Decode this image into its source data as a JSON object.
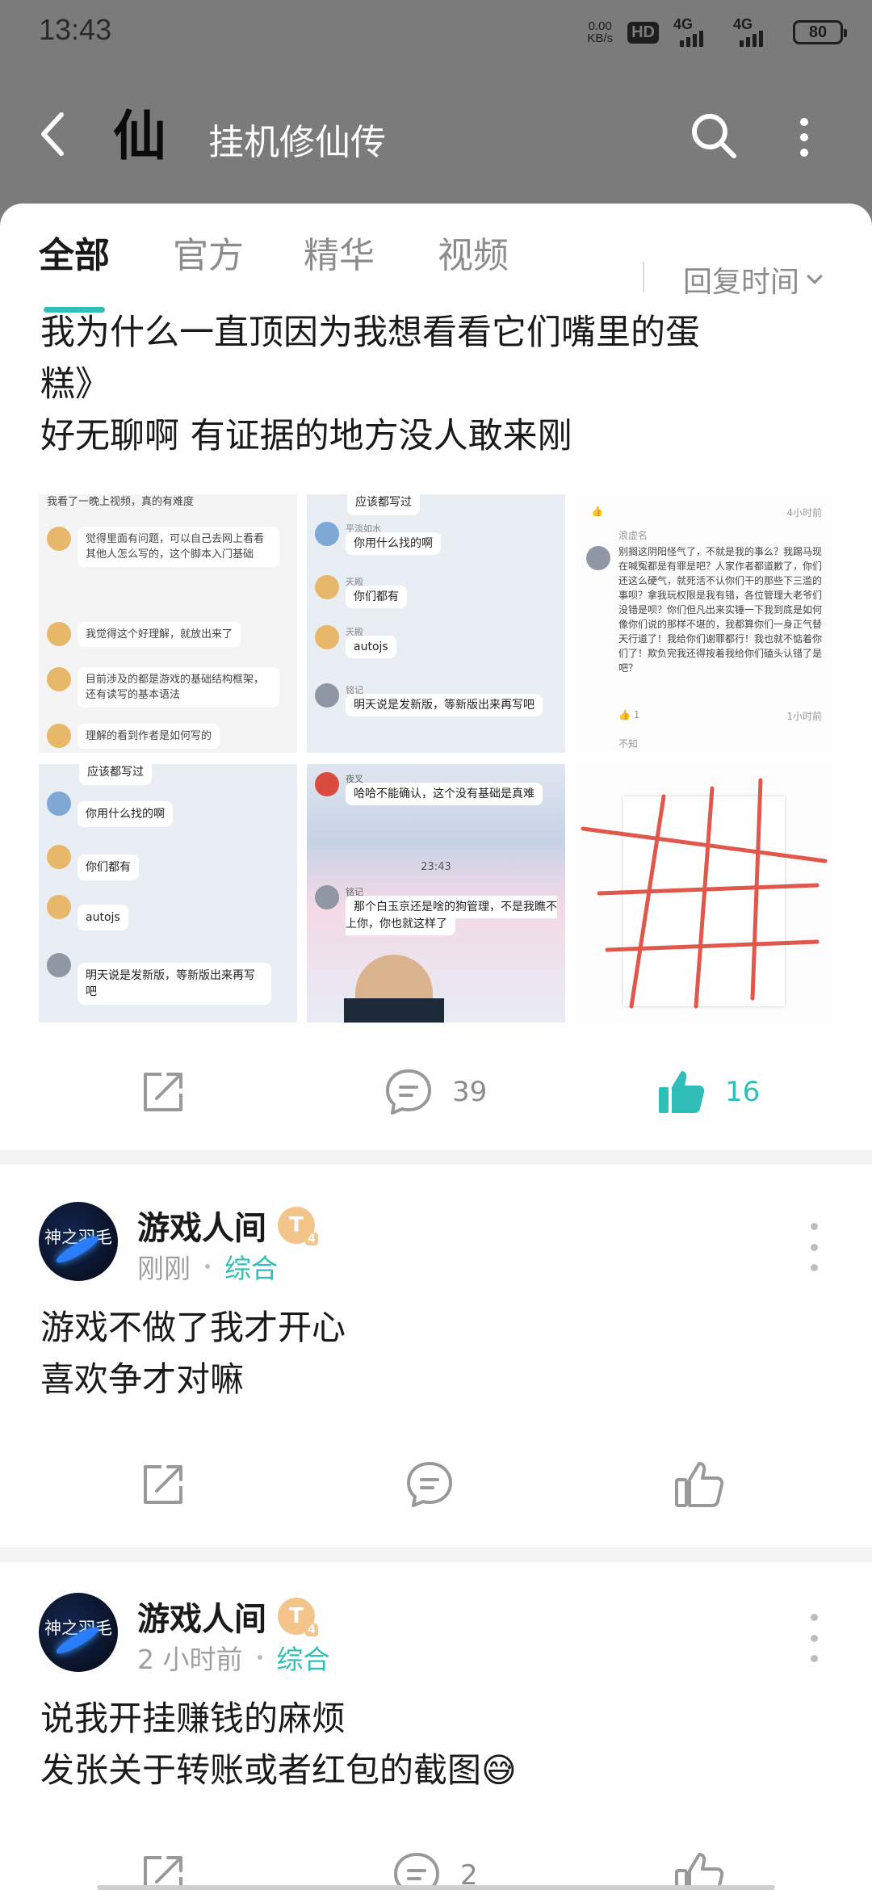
{
  "status_bar": {
    "time": "13:43",
    "net_speed_value": "0.00",
    "net_speed_unit": "KB/s",
    "hd": "HD",
    "sim1": "4G",
    "sim2": "4G",
    "battery": "80"
  },
  "header": {
    "logo_text": "仙",
    "title": "挂机修仙传"
  },
  "tabs": {
    "items": [
      {
        "label": "全部",
        "active": true
      },
      {
        "label": "官方",
        "active": false
      },
      {
        "label": "精华",
        "active": false
      },
      {
        "label": "视频",
        "active": false
      }
    ],
    "sort_label": "回复时间"
  },
  "post1": {
    "lines": [
      "我为什么一直顶因为我想看看它们嘴里的蛋",
      "糕》",
      "好无聊啊  有证据的地方没人敢来刚"
    ],
    "images": {
      "img1": {
        "lines": [
          "我看了一晚上视频，真的有难度",
          "觉得里面有问题，可以自己去网上看看其他人怎么写的，这个脚本入门基础",
          "我觉得这个好理解，就放出来了",
          "目前涉及的都是游戏的基础结构框架，还有读写的基本语法",
          "理解的看到作者是如何写的"
        ]
      },
      "img2": {
        "messages": [
          "应该都写过",
          "你用什么找的啊",
          "你们都有",
          "autojs",
          "明天说是发新版，等新版出来再写吧"
        ],
        "names": [
          "平淡如水",
          "天殿",
          "天殿",
          "铭记"
        ]
      },
      "img3": {
        "name": "浪虚名",
        "time1": "4小时前",
        "time2": "1小时前",
        "comment": "别搁这阴阳怪气了，不就是我的事么？我踢马现在喊冤都是有罪是吧？人家作者都道歉了，你们还这么硬气，就死活不认你们干的那些下三滥的事呗？拿我玩权限是我有错，各位管理大老爷们没错是呗？你们但凡出来实锤一下我到底是如何像你们说的那样不堪的，我都算你们一身正气替天行道了！我给你们谢罪都行！我也就不惦着你们了！欺负完我还得按着我给你们磕头认错了是吧？",
        "likes": "1",
        "reply_name": "不知"
      },
      "img4": {
        "messages": [
          "应该都写过",
          "你用什么找的啊",
          "你们都有",
          "autojs",
          "明天说是发新版，等新版出来再写吧"
        ]
      },
      "img5": {
        "messages": [
          "哈哈不能确认，这个没有基础是真难",
          "那个白玉京还是啥的狗管理，不是我瞧不上你，你也就这样了"
        ],
        "time": "23:43",
        "names": [
          "夜叉",
          "铭记"
        ]
      }
    },
    "share_count": "",
    "comment_count": "39",
    "like_count": "16"
  },
  "posts": [
    {
      "avatar_text": "神之羽毛",
      "author": "游戏人间",
      "level": "T",
      "level_sub": "4",
      "time": "刚刚",
      "category": "综合",
      "lines": [
        "游戏不做了我才开心",
        "喜欢争才对嘛"
      ],
      "comment_count": "",
      "like_count": ""
    },
    {
      "avatar_text": "神之羽毛",
      "author": "游戏人间",
      "level": "T",
      "level_sub": "4",
      "time": "2 小时前",
      "category": "综合",
      "lines": [
        "说我开挂赚钱的麻烦",
        "发张关于转账或者红包的截图😅"
      ],
      "comment_count": "2",
      "like_count": ""
    }
  ],
  "colors": {
    "accent": "#2fbfb8",
    "header_dim": "#7b7b7b"
  }
}
